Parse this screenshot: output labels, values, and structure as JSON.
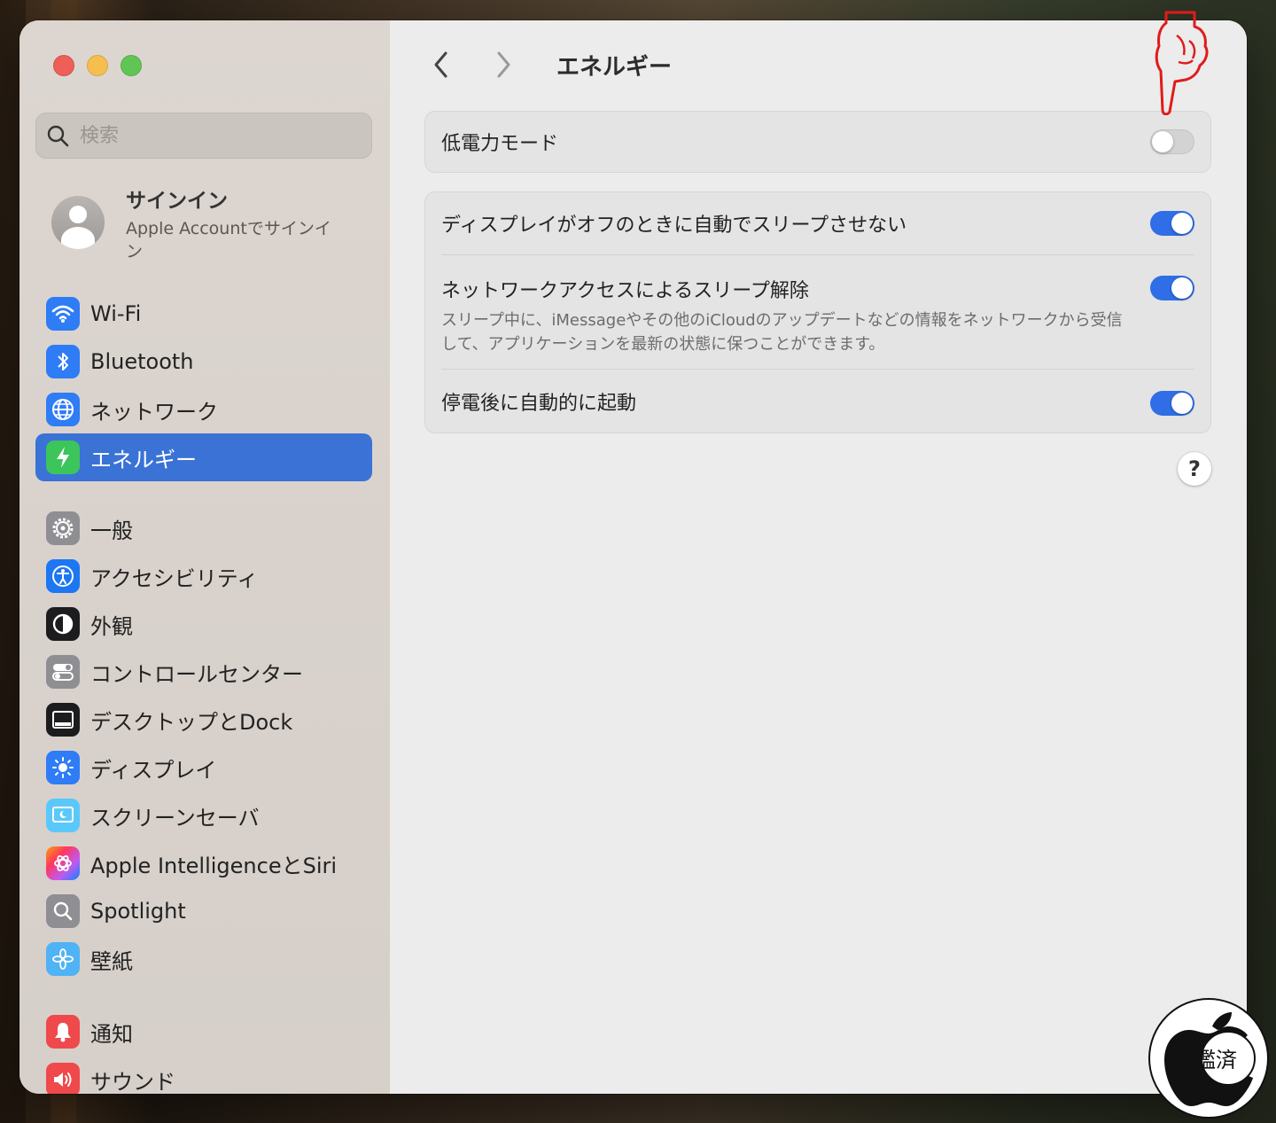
{
  "window": {
    "title": "エネルギー",
    "traffic_lights": {
      "close": "#ED5F57",
      "minimize": "#F5BE4F",
      "zoom": "#61C555"
    }
  },
  "sidebar": {
    "search_placeholder": "検索",
    "account": {
      "title": "サインイン",
      "subtitle": "Apple Accountでサインイン"
    },
    "items": [
      {
        "label": "Wi-Fi",
        "icon": "wifi-icon",
        "color": "#2E7CF6"
      },
      {
        "label": "Bluetooth",
        "icon": "bluetooth-icon",
        "color": "#2E7CF6"
      },
      {
        "label": "ネットワーク",
        "icon": "globe-icon",
        "color": "#2E7CF6"
      },
      {
        "label": "エネルギー",
        "icon": "bolt-icon",
        "color": "#3CC55A",
        "active": true
      },
      {
        "label": "一般",
        "icon": "gear-icon",
        "color": "#8E8E93"
      },
      {
        "label": "アクセシビリティ",
        "icon": "accessibility-icon",
        "color": "#1D76F2"
      },
      {
        "label": "外観",
        "icon": "appearance-icon",
        "color": "#1C1C1E"
      },
      {
        "label": "コントロールセンター",
        "icon": "control-center-icon",
        "color": "#8E8E93"
      },
      {
        "label": "デスクトップとDock",
        "icon": "dock-icon",
        "color": "#1C1C1E"
      },
      {
        "label": "ディスプレイ",
        "icon": "display-icon",
        "color": "#2E7CF6"
      },
      {
        "label": "スクリーンセーバ",
        "icon": "screensaver-icon",
        "color": "#5AC8FA"
      },
      {
        "label": "Apple IntelligenceとSiri",
        "icon": "siri-icon",
        "color": "#FF9F0A"
      },
      {
        "label": "Spotlight",
        "icon": "spotlight-icon",
        "color": "#8E8E93"
      },
      {
        "label": "壁紙",
        "icon": "wallpaper-icon",
        "color": "#4FB3F5"
      },
      {
        "label": "通知",
        "icon": "notification-icon",
        "color": "#F0494B"
      },
      {
        "label": "サウンド",
        "icon": "sound-icon",
        "color": "#F0494B"
      }
    ]
  },
  "main": {
    "back_label": "戻る",
    "forward_label": "進む",
    "low_power": {
      "label": "低電力モード",
      "on": false
    },
    "settings": [
      {
        "label": "ディスプレイがオフのときに自動でスリープさせない",
        "on": true
      },
      {
        "label": "ネットワークアクセスによるスリープ解除",
        "description": "スリープ中に、iMessageやその他のiCloudのアップデートなどの情報をネットワークから受信して、アプリケーションを最新の状態に保つことができます。",
        "on": true
      },
      {
        "label": "停電後に自動的に起動",
        "on": true
      }
    ],
    "help_label": "?"
  },
  "stamp_text": "鑑済"
}
